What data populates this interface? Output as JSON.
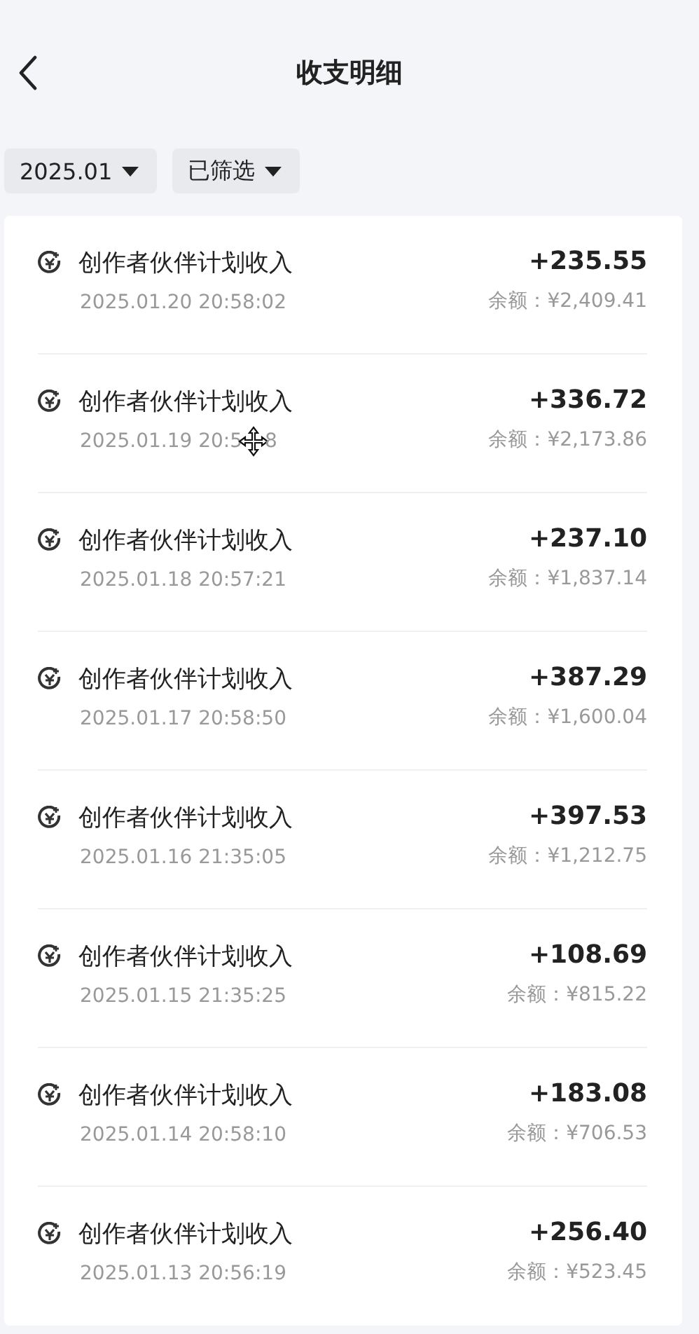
{
  "header": {
    "title": "收支明细"
  },
  "filters": [
    {
      "label": "2025.01"
    },
    {
      "label": "已筛选"
    }
  ],
  "records": [
    {
      "title": "创作者伙伴计划收入",
      "time": "2025.01.20 20:58:02",
      "amount": "+235.55",
      "balance": "余额：¥2,409.41"
    },
    {
      "title": "创作者伙伴计划收入",
      "time": "2025.01.19 20:5",
      "time_tail": "8",
      "amount": "+336.72",
      "balance": "余额：¥2,173.86",
      "cursor": true
    },
    {
      "title": "创作者伙伴计划收入",
      "time": "2025.01.18 20:57:21",
      "amount": "+237.10",
      "balance": "余额：¥1,837.14"
    },
    {
      "title": "创作者伙伴计划收入",
      "time": "2025.01.17 20:58:50",
      "amount": "+387.29",
      "balance": "余额：¥1,600.04"
    },
    {
      "title": "创作者伙伴计划收入",
      "time": "2025.01.16 21:35:05",
      "amount": "+397.53",
      "balance": "余额：¥1,212.75"
    },
    {
      "title": "创作者伙伴计划收入",
      "time": "2025.01.15 21:35:25",
      "amount": "+108.69",
      "balance": "余额：¥815.22"
    },
    {
      "title": "创作者伙伴计划收入",
      "time": "2025.01.14 20:58:10",
      "amount": "+183.08",
      "balance": "余额：¥706.53"
    },
    {
      "title": "创作者伙伴计划收入",
      "time": "2025.01.13 20:56:19",
      "amount": "+256.40",
      "balance": "余额：¥523.45"
    }
  ]
}
